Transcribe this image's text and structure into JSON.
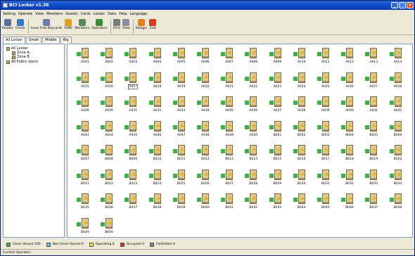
{
  "window": {
    "title": "BCI Locker v1.38"
  },
  "menu": [
    "Setting",
    "Operate",
    "View",
    "Members",
    "Guests",
    "Cards",
    "Locker",
    "Data",
    "Help",
    "Language"
  ],
  "toolbar": [
    {
      "label": "Reader",
      "icon": "card-reader-icon",
      "color": "#5a6e9a"
    },
    {
      "label": "Check",
      "icon": "check-icon",
      "color": "#3a78c8"
    },
    {
      "label": "Issue Free Keycards",
      "icon": "keycards-icon",
      "color": "#6a7ea8"
    },
    {
      "label": "SYNC",
      "icon": "sync-icon",
      "color": "#e0a020"
    },
    {
      "label": "Members",
      "icon": "members-icon",
      "color": "#5a8a5a"
    },
    {
      "label": "Operators",
      "icon": "operators-icon",
      "color": "#3a8a3a"
    },
    {
      "label": "Print",
      "icon": "printer-icon",
      "color": "#7a7a7a"
    },
    {
      "label": "View",
      "icon": "view-icon",
      "color": "#8a8aa0"
    },
    {
      "label": "Relogin",
      "icon": "relogin-icon",
      "color": "#e08020"
    },
    {
      "label": "Exit",
      "icon": "exit-icon",
      "color": "#d04020"
    }
  ],
  "tabs": [
    {
      "label": "All Locker",
      "active": true
    },
    {
      "label": "Small",
      "active": false
    },
    {
      "label": "Middle",
      "active": false
    },
    {
      "label": "Big",
      "active": false
    }
  ],
  "tree": [
    {
      "label": "All Locker",
      "level": 0,
      "color": "#d0b060"
    },
    {
      "label": "Zone A",
      "level": 1,
      "color": "#d0b060"
    },
    {
      "label": "Zone B",
      "level": 1,
      "color": "#d0b060"
    },
    {
      "label": "All Public doors",
      "level": 0,
      "color": "#d0b060"
    }
  ],
  "lockers": [
    "A001",
    "A002",
    "A003",
    "A004",
    "A005",
    "A006",
    "A007",
    "A008",
    "A009",
    "A010",
    "A011",
    "A012",
    "A013",
    "A014",
    "A015",
    "A016",
    "A017",
    "A018",
    "A019",
    "A020",
    "A021",
    "A022",
    "A023",
    "A024",
    "A025",
    "A026",
    "A027",
    "A028",
    "A029",
    "A030",
    "A031",
    "A032",
    "A033",
    "A034",
    "A035",
    "A036",
    "A037",
    "A038",
    "A039",
    "A040",
    "A041",
    "A042",
    "A043",
    "A044",
    "A045",
    "A046",
    "A047",
    "A048",
    "A049",
    "A050",
    "B001",
    "B002",
    "B003",
    "B004",
    "B005",
    "B006",
    "B007",
    "B008",
    "B009",
    "B010",
    "B011",
    "B012",
    "B013",
    "B014",
    "B015",
    "B016",
    "B017",
    "B018",
    "B019",
    "B020",
    "B021",
    "B022",
    "B023",
    "B024",
    "B025",
    "B026",
    "B027",
    "B028",
    "B029",
    "B030",
    "B031",
    "B032",
    "B033",
    "B034",
    "B035",
    "B036",
    "B037",
    "B038",
    "B039",
    "B040",
    "B041",
    "B042",
    "B043",
    "B044",
    "B045",
    "B046",
    "B047",
    "B048",
    "B049",
    "B050"
  ],
  "selected_locker": "A017",
  "locker_status_color": "#3cb043",
  "legend": [
    {
      "label": "Clean Vacant 100",
      "color": "#3cb043"
    },
    {
      "label": "Non Clean Vacant 0",
      "color": "#5bc0de"
    },
    {
      "label": "Operating 0",
      "color": "#f0e040"
    },
    {
      "label": "Occupied 0",
      "color": "#e02020"
    },
    {
      "label": "Forbidden 0",
      "color": "#808080"
    }
  ],
  "status": {
    "text": "Current Operator :"
  }
}
